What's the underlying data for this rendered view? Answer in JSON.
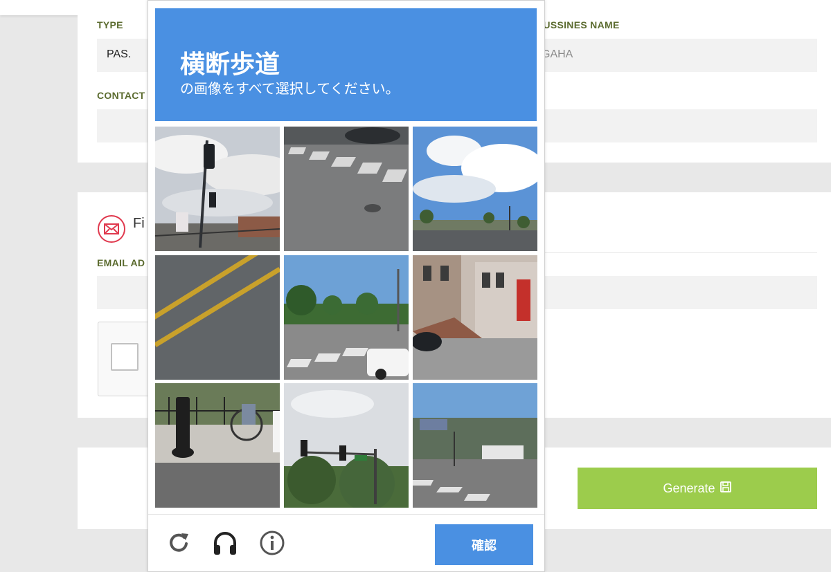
{
  "form": {
    "type_label": "TYPE",
    "type_value": "PAS.",
    "business_label": "BUSSINES NAME",
    "business_value": "GAHA",
    "contact_label": "CONTACT",
    "section_title": "Fi",
    "email_label": "EMAIL AD",
    "generate_label": "Generate"
  },
  "captcha": {
    "title": "横断歩道",
    "subtitle": "の画像をすべて選択してください。",
    "verify_label": "確認",
    "accent_color": "#4a90e2",
    "tiles": [
      {
        "scene": "traffic-light-pole"
      },
      {
        "scene": "crosswalk-asphalt"
      },
      {
        "scene": "sky-clouds-palms"
      },
      {
        "scene": "road-yellow-lines"
      },
      {
        "scene": "intersection-crosswalk"
      },
      {
        "scene": "townhouse-street"
      },
      {
        "scene": "sidewalk-wheelchair"
      },
      {
        "scene": "traffic-signals-trees"
      },
      {
        "scene": "street-crosswalk-truck"
      }
    ],
    "footer_icons": [
      "reload-icon",
      "headphones-icon",
      "info-icon"
    ]
  }
}
